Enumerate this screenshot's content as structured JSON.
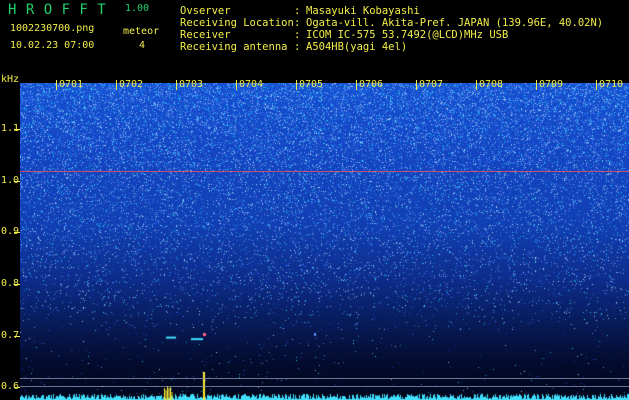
{
  "app": {
    "title": "H R O F F T",
    "version": "1.00",
    "filename": "1002230700.png",
    "timestamp": "10.02.23 07:00",
    "meteor_label": "meteor",
    "meteor_count": "4"
  },
  "info": [
    {
      "key": "Ovserver",
      "sep": ":",
      "value": "Masayuki Kobayashi"
    },
    {
      "key": "Receiving Location",
      "sep": ":",
      "value": "Ogata-vill. Akita-Pref. JAPAN (139.96E, 40.02N)"
    },
    {
      "key": "Receiver",
      "sep": ":",
      "value": "ICOM IC-575 53.7492(@LCD)MHz USB"
    },
    {
      "key": "Receiving antenna",
      "sep": ":",
      "value": "A504HB(yagi 4el)"
    }
  ],
  "chart_data": {
    "type": "heatmap",
    "ylabel": "kHz",
    "y_ticks": [
      "1.1",
      "1.0",
      "0.9",
      "0.8",
      "0.7",
      "0.6"
    ],
    "y_tick_values": [
      1.1,
      1.0,
      0.9,
      0.8,
      0.7,
      0.6
    ],
    "ylim": [
      0.575,
      1.19
    ],
    "x_ticks": [
      "0701",
      "0702",
      "0703",
      "0704",
      "0705",
      "0706",
      "0707",
      "0708",
      "0709",
      "0710"
    ],
    "x_tick_values": [
      1,
      2,
      3,
      4,
      5,
      6,
      7,
      8,
      9,
      10
    ],
    "xlim": [
      0.4,
      10.55
    ],
    "reference_line_khz": 1.02,
    "meteor_events_minute": [
      2.8,
      3.45,
      3.25,
      5.3
    ],
    "colors": {
      "text": "#f2ee4a",
      "title": "#21d16c",
      "reference": "#ff5050",
      "baseline": "#40e0ff"
    }
  }
}
